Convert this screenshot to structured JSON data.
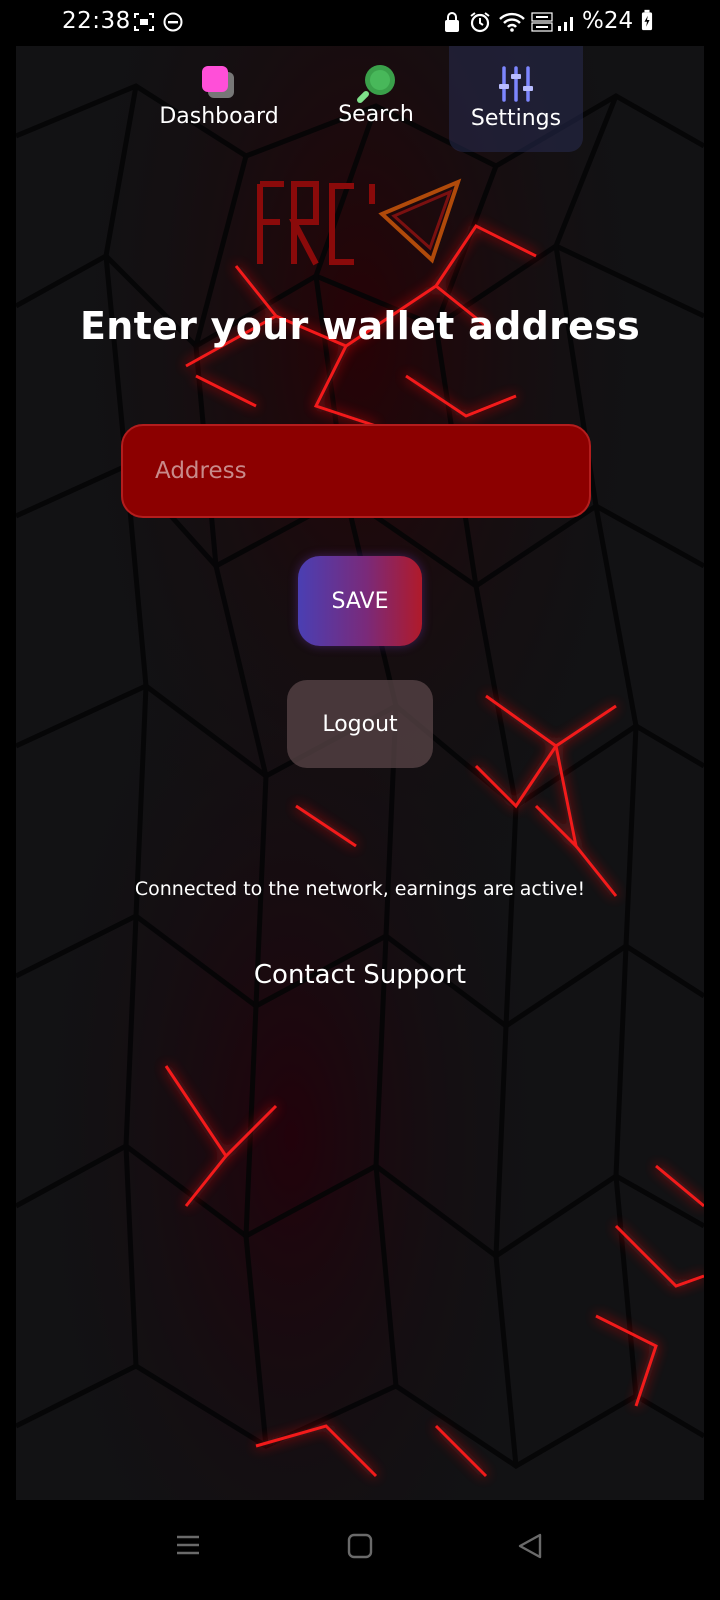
{
  "status_bar": {
    "time": "22:38",
    "battery": "%24",
    "icons": [
      "screenshot-icon",
      "do-not-disturb-icon",
      "lock-icon",
      "alarm-icon",
      "wifi-icon",
      "volte-icon",
      "signal-icon",
      "battery-charging-icon"
    ]
  },
  "tabs": [
    {
      "label": "Dashboard",
      "icon": "dashboard-icon"
    },
    {
      "label": "Search",
      "icon": "search-icon"
    },
    {
      "label": "Settings",
      "icon": "settings-sliders-icon",
      "active": true
    }
  ],
  "main": {
    "title": "Enter your wallet address",
    "address_placeholder": "Address",
    "address_value": "",
    "save_label": "SAVE",
    "logout_label": "Logout",
    "status_message": "Connected to the network, earnings are active!",
    "support_label": "Contact Support"
  },
  "colors": {
    "accent_red": "#e0101a",
    "input_bg": "#8c0000",
    "save_gradient_start": "#4a3fb3",
    "save_gradient_end": "#b01a2a",
    "active_tab_bg": "#282c50"
  }
}
